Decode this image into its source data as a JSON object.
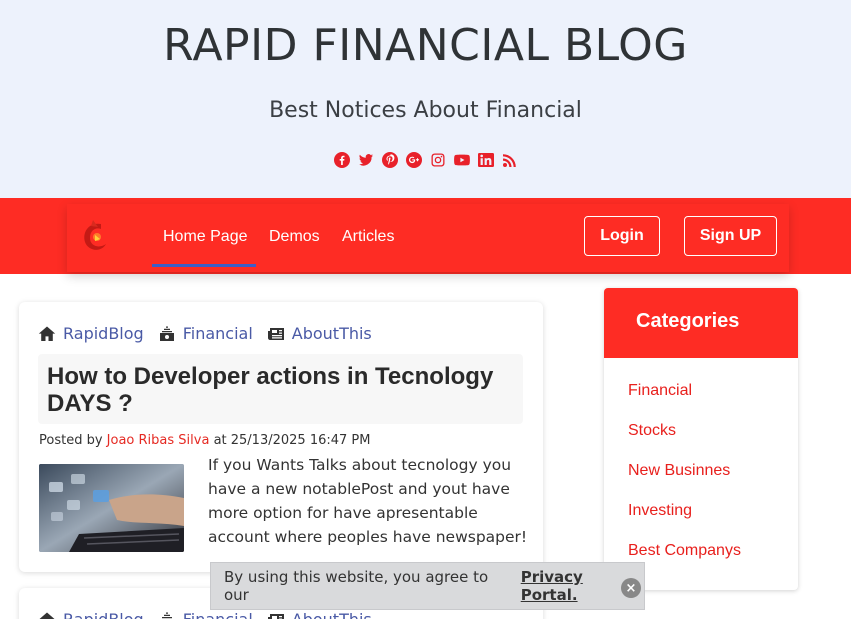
{
  "header": {
    "title": "RAPID FINANCIAL BLOG",
    "subtitle": "Best Notices About Financial",
    "social_icons": [
      "facebook-icon",
      "twitter-icon",
      "pinterest-icon",
      "google-plus-icon",
      "instagram-icon",
      "youtube-icon",
      "linkedin-icon",
      "rss-icon"
    ],
    "accent_color": "#e8212a"
  },
  "navbar": {
    "background": "#fe2c24",
    "links": [
      "Home Page",
      "Demos",
      "Articles"
    ],
    "active": "Home Page",
    "login_label": "Login",
    "signup_label": "Sign UP"
  },
  "posts": [
    {
      "categories": [
        {
          "icon": "home-icon",
          "label": "RapidBlog"
        },
        {
          "icon": "cash-icon",
          "label": "Financial"
        },
        {
          "icon": "newspaper-icon",
          "label": "AboutThis"
        }
      ],
      "title": "How to Developer actions in Tecnology DAYS ?",
      "posted_prefix": "Posted by",
      "author": "Joao Ribas Silva",
      "posted_at": "at 25/13/2025 16:47 PM",
      "excerpt": "If you Wants Talks about tecnology you have a new notablePost and yout have more option for have apresentable account where peoples have newspaper!"
    },
    {
      "categories": [
        {
          "icon": "home-icon",
          "label": "RapidBlog"
        },
        {
          "icon": "cash-icon",
          "label": "Financial"
        },
        {
          "icon": "newspaper-icon",
          "label": "AboutThis"
        }
      ]
    }
  ],
  "sidebar": {
    "title": "Categories",
    "items": [
      "Financial",
      "Stocks",
      "New Businnes",
      "Investing",
      "Best Companys"
    ]
  },
  "cookie": {
    "text": "By using this website, you agree to our",
    "link": "Privacy Portal.",
    "close": "×"
  }
}
